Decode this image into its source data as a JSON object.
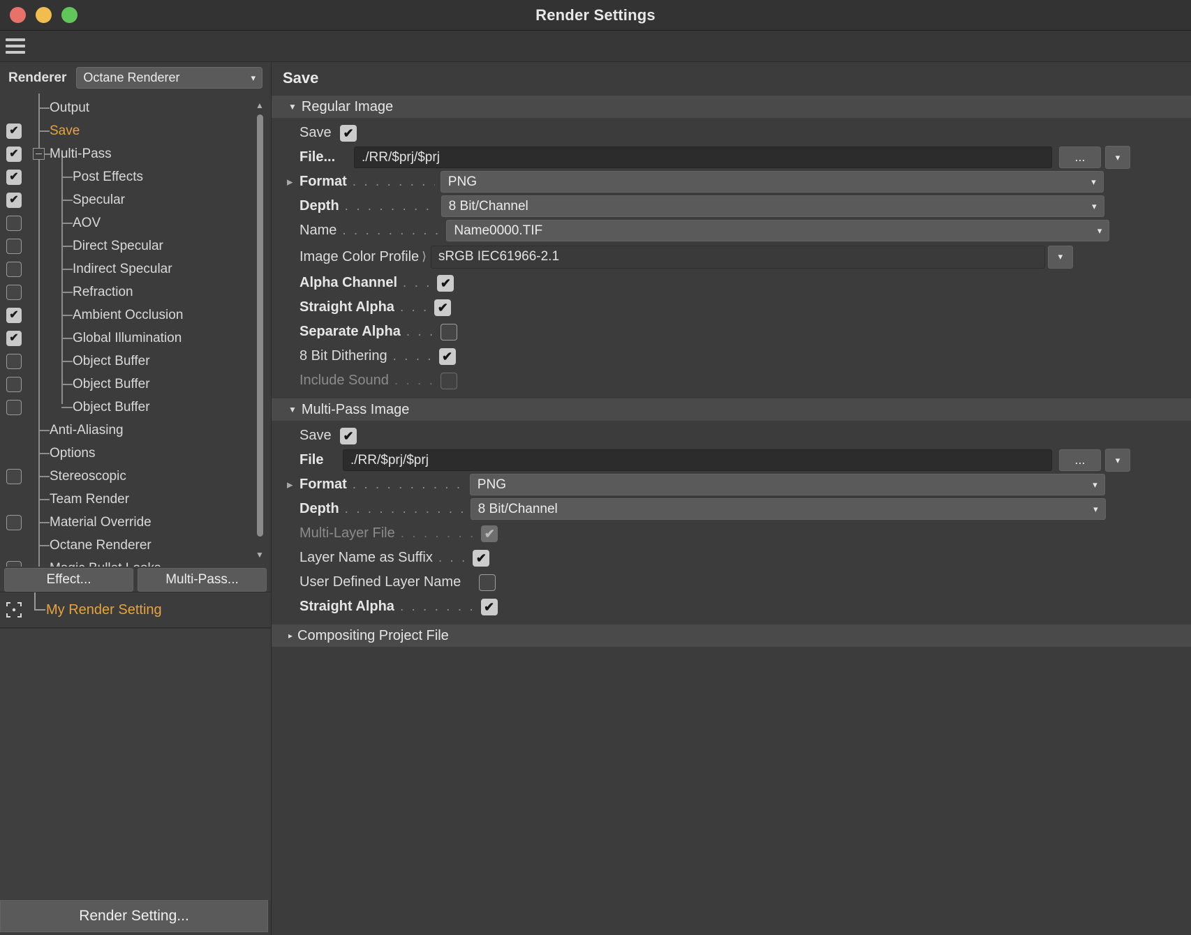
{
  "window": {
    "title": "Render Settings",
    "traffic_lights": [
      "close-button",
      "minimize-button",
      "zoom-button"
    ]
  },
  "sidebar": {
    "renderer_label": "Renderer",
    "renderer_value": "Octane Renderer",
    "tree": [
      {
        "label": "Output",
        "checkbox": "none",
        "depth": 1,
        "selected": false
      },
      {
        "label": "Save",
        "checkbox": "on",
        "depth": 1,
        "selected": true
      },
      {
        "label": "Multi-Pass",
        "checkbox": "on",
        "depth": 1,
        "selected": false,
        "expander": "minus"
      },
      {
        "label": "Post Effects",
        "checkbox": "on",
        "depth": 2,
        "selected": false
      },
      {
        "label": "Specular",
        "checkbox": "on",
        "depth": 2,
        "selected": false
      },
      {
        "label": "AOV",
        "checkbox": "off",
        "depth": 2,
        "selected": false
      },
      {
        "label": "Direct Specular",
        "checkbox": "off",
        "depth": 2,
        "selected": false
      },
      {
        "label": "Indirect Specular",
        "checkbox": "off",
        "depth": 2,
        "selected": false
      },
      {
        "label": "Refraction",
        "checkbox": "off",
        "depth": 2,
        "selected": false
      },
      {
        "label": "Ambient Occlusion",
        "checkbox": "on",
        "depth": 2,
        "selected": false
      },
      {
        "label": "Global Illumination",
        "checkbox": "on",
        "depth": 2,
        "selected": false
      },
      {
        "label": "Object Buffer",
        "checkbox": "off",
        "depth": 2,
        "selected": false
      },
      {
        "label": "Object Buffer",
        "checkbox": "off",
        "depth": 2,
        "selected": false
      },
      {
        "label": "Object Buffer",
        "checkbox": "off",
        "depth": 2,
        "selected": false,
        "last": true
      },
      {
        "label": "Anti-Aliasing",
        "checkbox": "none",
        "depth": 1,
        "selected": false
      },
      {
        "label": "Options",
        "checkbox": "none",
        "depth": 1,
        "selected": false
      },
      {
        "label": "Stereoscopic",
        "checkbox": "off",
        "depth": 1,
        "selected": false
      },
      {
        "label": "Team Render",
        "checkbox": "none",
        "depth": 1,
        "selected": false
      },
      {
        "label": "Material Override",
        "checkbox": "off",
        "depth": 1,
        "selected": false
      },
      {
        "label": "Octane Renderer",
        "checkbox": "none",
        "depth": 1,
        "selected": false
      },
      {
        "label": "Magic Bullet Looks",
        "checkbox": "off",
        "depth": 1,
        "selected": false,
        "clipped": true
      }
    ],
    "buttons": {
      "effect": "Effect...",
      "multipass": "Multi-Pass..."
    },
    "render_setting_name": "My Render Setting",
    "bottom_button": "Render Setting..."
  },
  "main": {
    "title": "Save",
    "regular_image": {
      "group_label": "Regular Image",
      "expanded": true,
      "save_label": "Save",
      "save_checked": true,
      "file_label": "File...",
      "file_value": "./RR/$prj/$prj",
      "browse_label": "...",
      "format_label": "Format",
      "format_value": "PNG",
      "depth_label": "Depth",
      "depth_value": "8 Bit/Channel",
      "name_label": "Name",
      "name_value": "Name0000.TIF",
      "color_profile_label": "Image Color Profile",
      "color_profile_value": "sRGB IEC61966-2.1",
      "checkboxes": [
        {
          "label": "Alpha Channel",
          "state": "on",
          "bold": true,
          "disabled": false,
          "dots": ". . ."
        },
        {
          "label": "Straight Alpha",
          "state": "on",
          "bold": true,
          "disabled": false,
          "dots": ". . ."
        },
        {
          "label": "Separate Alpha",
          "state": "off",
          "bold": true,
          "disabled": false,
          "dots": ". . ."
        },
        {
          "label": "8 Bit Dithering",
          "state": "on",
          "bold": false,
          "disabled": false,
          "dots": ". . . ."
        },
        {
          "label": "Include Sound",
          "state": "off",
          "bold": false,
          "disabled": true,
          "dots": ". . . ."
        }
      ]
    },
    "multipass_image": {
      "group_label": "Multi-Pass Image",
      "expanded": true,
      "save_label": "Save",
      "save_checked": true,
      "file_label": "File",
      "file_value": "./RR/$prj/$prj",
      "browse_label": "...",
      "format_label": "Format",
      "format_value": "PNG",
      "depth_label": "Depth",
      "depth_value": "8 Bit/Channel",
      "checkboxes": [
        {
          "label": "Multi-Layer File",
          "state": "on",
          "bold": false,
          "disabled": true,
          "dots": ". . . . . . ."
        },
        {
          "label": "Layer Name as Suffix",
          "state": "on",
          "bold": false,
          "disabled": false,
          "dots": ". . ."
        },
        {
          "label": "User Defined Layer Name",
          "state": "off",
          "bold": false,
          "disabled": false,
          "dots": ""
        },
        {
          "label": "Straight Alpha",
          "state": "on",
          "bold": true,
          "disabled": false,
          "dots": ". . . . . . ."
        }
      ]
    },
    "compositing": {
      "group_label": "Compositing Project File",
      "expanded": false
    }
  },
  "colors": {
    "accent": "#e8a33d",
    "panel_bg": "#3c3c3c",
    "titlebar_bg": "#333333",
    "group_header_bg": "#4a4a4a",
    "field_bg": "#5a5a5a",
    "input_bg": "#2c2c2c"
  }
}
